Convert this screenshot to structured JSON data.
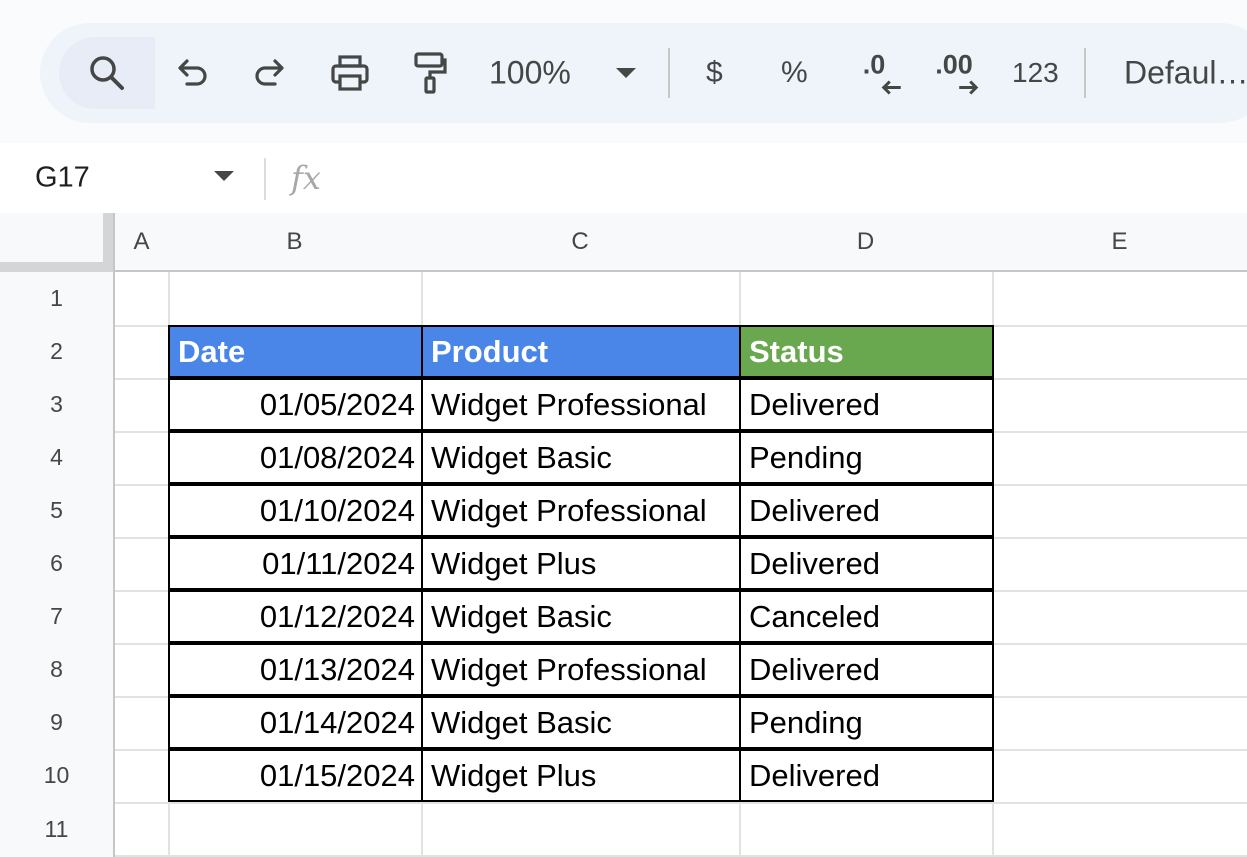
{
  "toolbar": {
    "zoom": "100%",
    "currency_label": "$",
    "percent_label": "%",
    "decrease_decimal_label": ".0",
    "increase_decimal_label": ".00",
    "number_format_label": "123",
    "font_name": "Defaul…",
    "icons": [
      "search-icon",
      "undo-icon",
      "redo-icon",
      "print-icon",
      "paint-format-icon",
      "chevron-down-icon"
    ]
  },
  "formula_bar": {
    "cell_ref": "G17",
    "fx_label": "fx",
    "formula": ""
  },
  "columns": [
    "A",
    "B",
    "C",
    "D",
    "E"
  ],
  "rows": [
    "1",
    "2",
    "3",
    "4",
    "5",
    "6",
    "7",
    "8",
    "9",
    "10",
    "11"
  ],
  "table": {
    "headers": [
      "Date",
      "Product",
      "Status"
    ],
    "header_colors": [
      "#4a86e8",
      "#4a86e8",
      "#6aa84f"
    ],
    "rows": [
      [
        "01/05/2024",
        "Widget Professional",
        "Delivered"
      ],
      [
        "01/08/2024",
        "Widget Basic",
        "Pending"
      ],
      [
        "01/10/2024",
        "Widget Professional",
        "Delivered"
      ],
      [
        "01/11/2024",
        "Widget Plus",
        "Delivered"
      ],
      [
        "01/12/2024",
        "Widget Basic",
        "Canceled"
      ],
      [
        "01/13/2024",
        "Widget Professional",
        "Delivered"
      ],
      [
        "01/14/2024",
        "Widget Basic",
        "Pending"
      ],
      [
        "01/15/2024",
        "Widget Plus",
        "Delivered"
      ]
    ]
  }
}
